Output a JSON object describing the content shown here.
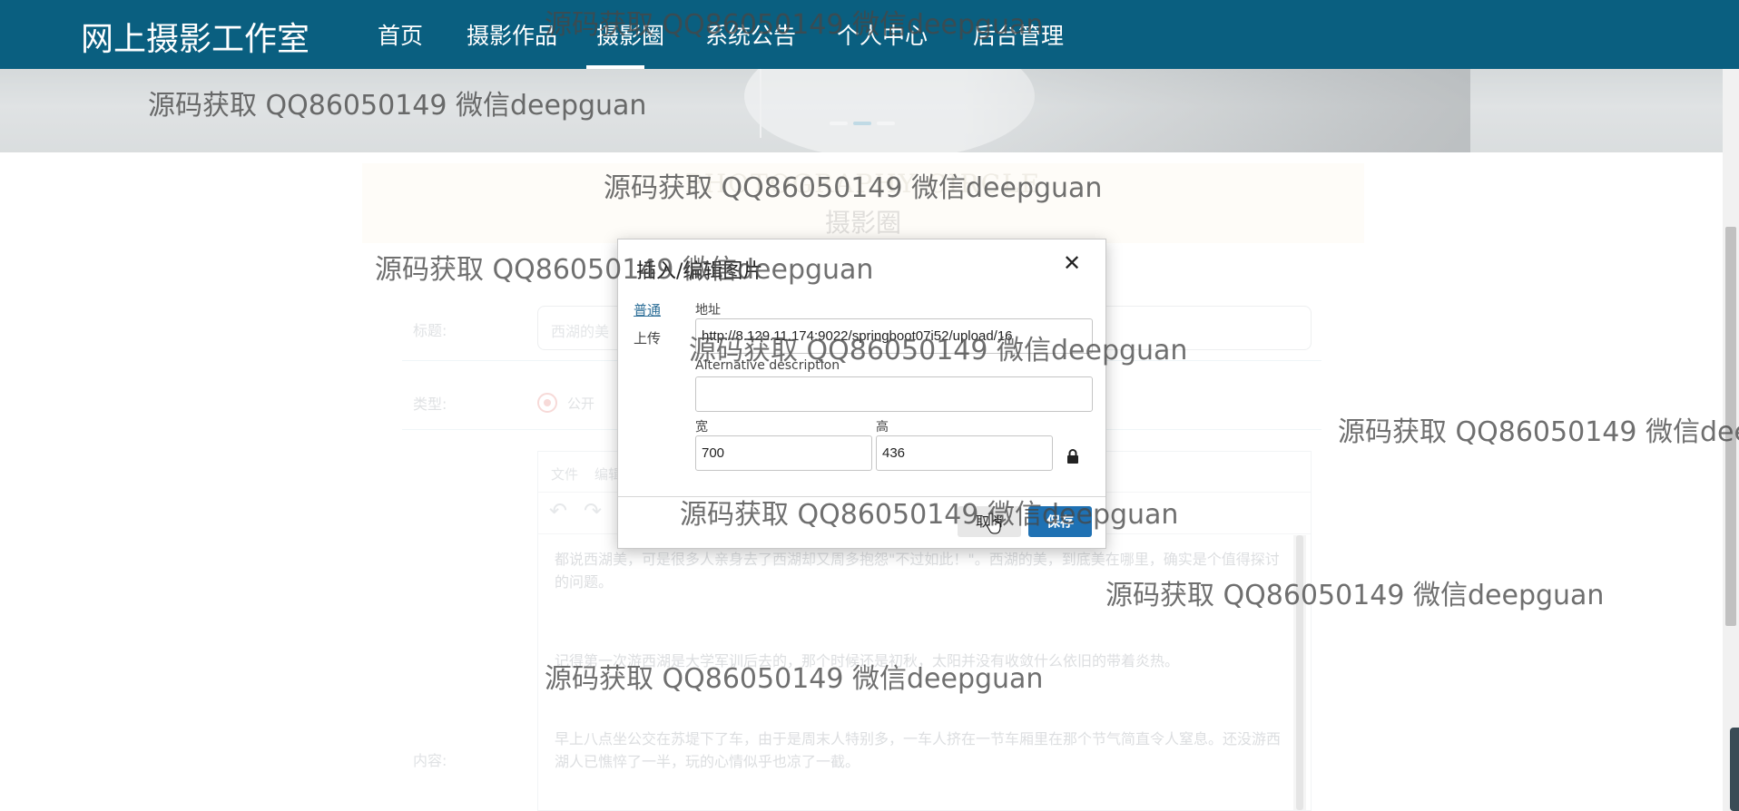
{
  "nav": {
    "brand": "网上摄影工作室",
    "items": [
      "首页",
      "摄影作品",
      "摄影圈",
      "系统公告",
      "个人中心",
      "后台管理"
    ],
    "active": "摄影圈"
  },
  "page": {
    "title_en": "PHOTOGRAPHY CIRCLE",
    "title_cn": "摄影圈",
    "form": {
      "title_label": "标题:",
      "title_value": "西湖的美",
      "type_label": "类型:",
      "type_option": "公开",
      "content_label": "内容:",
      "editor_menu": [
        "文件",
        "编辑"
      ],
      "paragraphs": [
        "都说西湖美，可是很多人亲身去了西湖却又周多抱怨\"不过如此！\"。西湖的美，到底美在哪里，确实是个值得探讨的问题。",
        "记得第一次游西湖是大学军训后去的，那个时候还是初秋，太阳并没有收敛什么依旧的带着炎热。",
        "早上八点坐公交在苏堤下了车，由于是周末人特别多，一车人挤在一节车厢里在那个节气简直令人窒息。还没游西湖人已憔悴了一半，玩的心情似乎也凉了一截。"
      ]
    }
  },
  "dialog": {
    "title": "插入/编辑图片",
    "tabs": [
      "普通",
      "上传"
    ],
    "url_label": "地址",
    "url_value": "http://8.129.11.174:9022/springboot07i52/upload/16",
    "alt_label": "Alternative description",
    "alt_value": "",
    "width_label": "宽",
    "width_value": "700",
    "height_label": "高",
    "height_value": "436",
    "cancel_label": "取消",
    "save_label": "保存"
  },
  "watermark": {
    "text": "源码获取 QQ86050149 微信deepguan"
  },
  "colors": {
    "nav_bg": "#0a5f80",
    "save_button": "#1f71b3",
    "active_tab": "#2e6f98"
  },
  "icons": [
    "close-icon",
    "lock-icon",
    "undo-icon",
    "redo-icon",
    "mouse-cursor-icon"
  ]
}
